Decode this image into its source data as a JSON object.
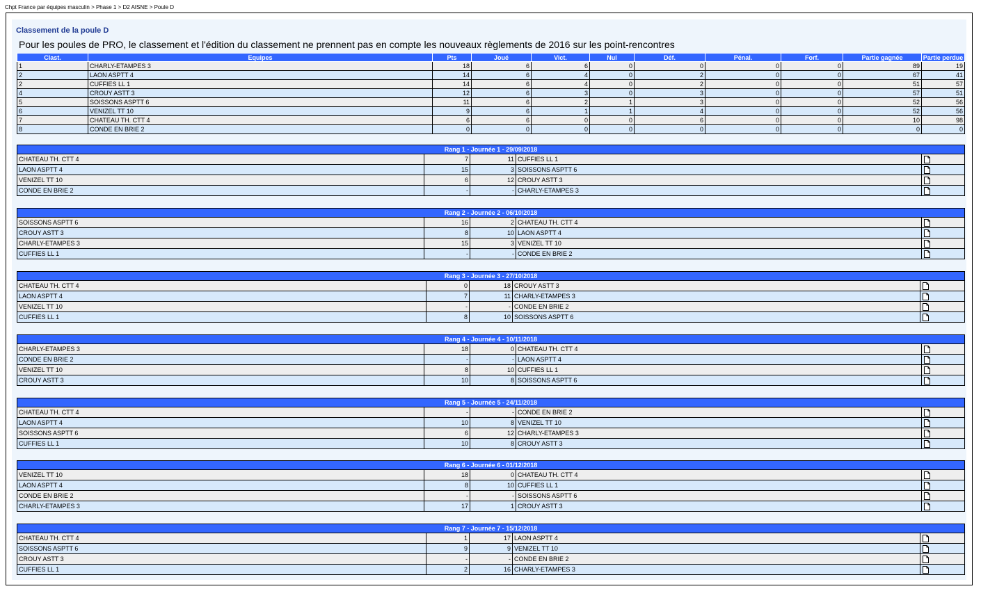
{
  "breadcrumb": [
    "Chpt France par équipes masculin",
    "Phase 1",
    "D2 AISNE",
    "Poule D"
  ],
  "breadcrumb_sep": " > ",
  "page_title": "Classement de la poule D",
  "notice": "Pour les poules de PRO, le classement et l'édition du classement ne prennent pas en compte les nouveaux règlements de 2016 sur les point-rencontres",
  "ranking": {
    "headers": [
      "Clast.",
      "Equipes",
      "Pts",
      "Joué",
      "Vict.",
      "Nul",
      "Déf.",
      "Pénal.",
      "Forf.",
      "Partie gagnée",
      "Partie perdue"
    ],
    "rows": [
      [
        "1",
        "CHARLY-ETAMPES 3",
        "18",
        "6",
        "6",
        "0",
        "0",
        "0",
        "0",
        "89",
        "19"
      ],
      [
        "2",
        "LAON ASPTT 4",
        "14",
        "6",
        "4",
        "0",
        "2",
        "0",
        "0",
        "67",
        "41"
      ],
      [
        "2",
        "CUFFIES LL 1",
        "14",
        "6",
        "4",
        "0",
        "2",
        "0",
        "0",
        "51",
        "57"
      ],
      [
        "4",
        "CROUY ASTT 3",
        "12",
        "6",
        "3",
        "0",
        "3",
        "0",
        "0",
        "57",
        "51"
      ],
      [
        "5",
        "SOISSONS ASPTT 6",
        "11",
        "6",
        "2",
        "1",
        "3",
        "0",
        "0",
        "52",
        "56"
      ],
      [
        "6",
        "VENIZEL TT 10",
        "9",
        "6",
        "1",
        "1",
        "4",
        "0",
        "0",
        "52",
        "56"
      ],
      [
        "7",
        "CHATEAU TH. CTT 4",
        "6",
        "6",
        "0",
        "0",
        "6",
        "0",
        "0",
        "10",
        "98"
      ],
      [
        "8",
        "CONDE EN BRIE 2",
        "0",
        "0",
        "0",
        "0",
        "0",
        "0",
        "0",
        "0",
        "0"
      ]
    ]
  },
  "icons": {
    "match_sheet": "document-icon"
  },
  "days": [
    {
      "title": "Rang 1 - Journée 1 - 29/09/2018",
      "matches": [
        [
          "CHATEAU TH. CTT 4",
          "7",
          "11",
          "CUFFIES LL 1"
        ],
        [
          "LAON ASPTT 4",
          "15",
          "3",
          "SOISSONS ASPTT 6"
        ],
        [
          "VENIZEL TT 10",
          "6",
          "12",
          "CROUY ASTT 3"
        ],
        [
          "CONDE EN BRIE 2",
          "-",
          "-",
          "CHARLY-ETAMPES 3"
        ]
      ]
    },
    {
      "title": "Rang 2 - Journée 2 - 06/10/2018",
      "matches": [
        [
          "SOISSONS ASPTT 6",
          "16",
          "2",
          "CHATEAU TH. CTT 4"
        ],
        [
          "CROUY ASTT 3",
          "8",
          "10",
          "LAON ASPTT 4"
        ],
        [
          "CHARLY-ETAMPES 3",
          "15",
          "3",
          "VENIZEL TT 10"
        ],
        [
          "CUFFIES LL 1",
          "-",
          "-",
          "CONDE EN BRIE 2"
        ]
      ]
    },
    {
      "title": "Rang 3 - Journée 3 - 27/10/2018",
      "matches": [
        [
          "CHATEAU TH. CTT 4",
          "0",
          "18",
          "CROUY ASTT 3"
        ],
        [
          "LAON ASPTT 4",
          "7",
          "11",
          "CHARLY-ETAMPES 3"
        ],
        [
          "VENIZEL TT 10",
          "-",
          "-",
          "CONDE EN BRIE 2"
        ],
        [
          "CUFFIES LL 1",
          "8",
          "10",
          "SOISSONS ASPTT 6"
        ]
      ]
    },
    {
      "title": "Rang 4 - Journée 4 - 10/11/2018",
      "matches": [
        [
          "CHARLY-ETAMPES 3",
          "18",
          "0",
          "CHATEAU TH. CTT 4"
        ],
        [
          "CONDE EN BRIE 2",
          "-",
          "-",
          "LAON ASPTT 4"
        ],
        [
          "VENIZEL TT 10",
          "8",
          "10",
          "CUFFIES LL 1"
        ],
        [
          "CROUY ASTT 3",
          "10",
          "8",
          "SOISSONS ASPTT 6"
        ]
      ]
    },
    {
      "title": "Rang 5 - Journée 5 - 24/11/2018",
      "matches": [
        [
          "CHATEAU TH. CTT 4",
          "-",
          "-",
          "CONDE EN BRIE 2"
        ],
        [
          "LAON ASPTT 4",
          "10",
          "8",
          "VENIZEL TT 10"
        ],
        [
          "SOISSONS ASPTT 6",
          "6",
          "12",
          "CHARLY-ETAMPES 3"
        ],
        [
          "CUFFIES LL 1",
          "10",
          "8",
          "CROUY ASTT 3"
        ]
      ]
    },
    {
      "title": "Rang 6 - Journée 6 - 01/12/2018",
      "matches": [
        [
          "VENIZEL TT 10",
          "18",
          "0",
          "CHATEAU TH. CTT 4"
        ],
        [
          "LAON ASPTT 4",
          "8",
          "10",
          "CUFFIES LL 1"
        ],
        [
          "CONDE EN BRIE 2",
          "-",
          "-",
          "SOISSONS ASPTT 6"
        ],
        [
          "CHARLY-ETAMPES 3",
          "17",
          "1",
          "CROUY ASTT 3"
        ]
      ]
    },
    {
      "title": "Rang 7 - Journée 7 - 15/12/2018",
      "matches": [
        [
          "CHATEAU TH. CTT 4",
          "1",
          "17",
          "LAON ASPTT 4"
        ],
        [
          "SOISSONS ASPTT 6",
          "9",
          "9",
          "VENIZEL TT 10"
        ],
        [
          "CROUY ASTT 3",
          "-",
          "-",
          "CONDE EN BRIE 2"
        ],
        [
          "CUFFIES LL 1",
          "2",
          "16",
          "CHARLY-ETAMPES 3"
        ]
      ]
    }
  ]
}
